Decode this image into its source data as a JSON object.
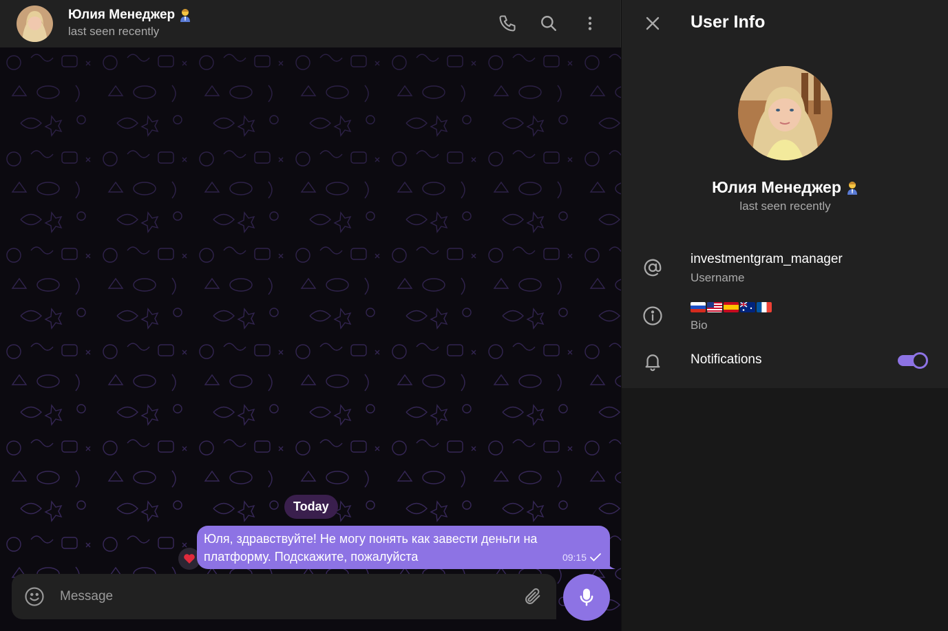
{
  "chat": {
    "contact_name": "Юлия Менеджер",
    "status": "last seen recently",
    "date_separator": "Today",
    "message": {
      "text_line1": "Юля, здравствуйте! Не могу понять как завести деньги на",
      "text_line2": "платформу. Подскажите, пожалуйста",
      "time": "09:15",
      "reaction": "heart"
    },
    "composer": {
      "placeholder": "Message"
    }
  },
  "info": {
    "title": "User Info",
    "name": "Юлия Менеджер",
    "status": "last seen recently",
    "username": "investmentgram_manager",
    "username_label": "Username",
    "bio_label": "Bio",
    "bio_flags": [
      "RU",
      "US",
      "ES",
      "AU",
      "FR"
    ],
    "notifications_label": "Notifications",
    "notifications_on": true
  },
  "colors": {
    "accent": "#8d73e4",
    "panel": "#212121",
    "background": "#181818",
    "muted_text": "#aaaaaa"
  }
}
